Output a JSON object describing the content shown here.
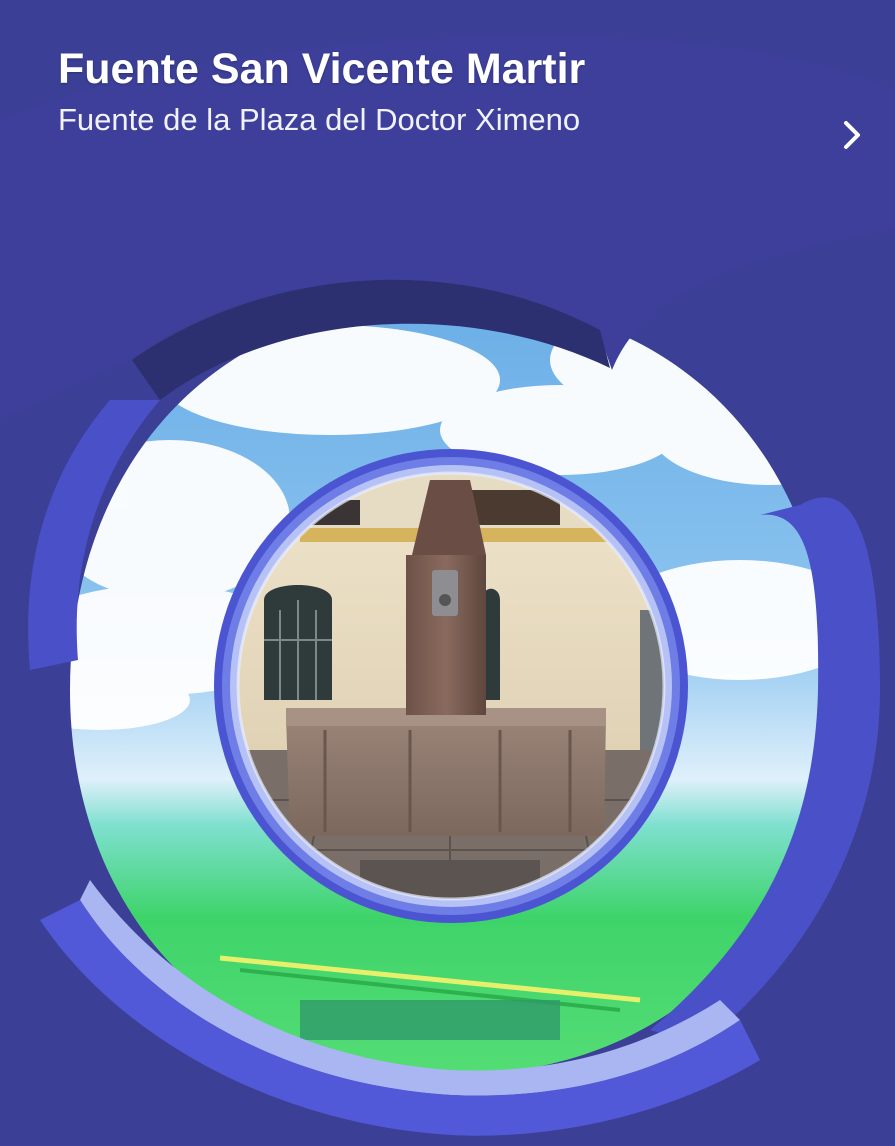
{
  "poi": {
    "title": "Fuente San Vicente Martir",
    "description": "Fuente de la Plaza del Doctor Ximeno"
  },
  "colors": {
    "disc_blue": "#3b3f96",
    "disc_edge": "#4f5bd6",
    "ring_light": "#a9b6f2",
    "sky": "#6aaee6",
    "grass": "#35d35a",
    "title_text": "#ffffff"
  },
  "icons": {
    "details": "chevron-right-icon"
  }
}
